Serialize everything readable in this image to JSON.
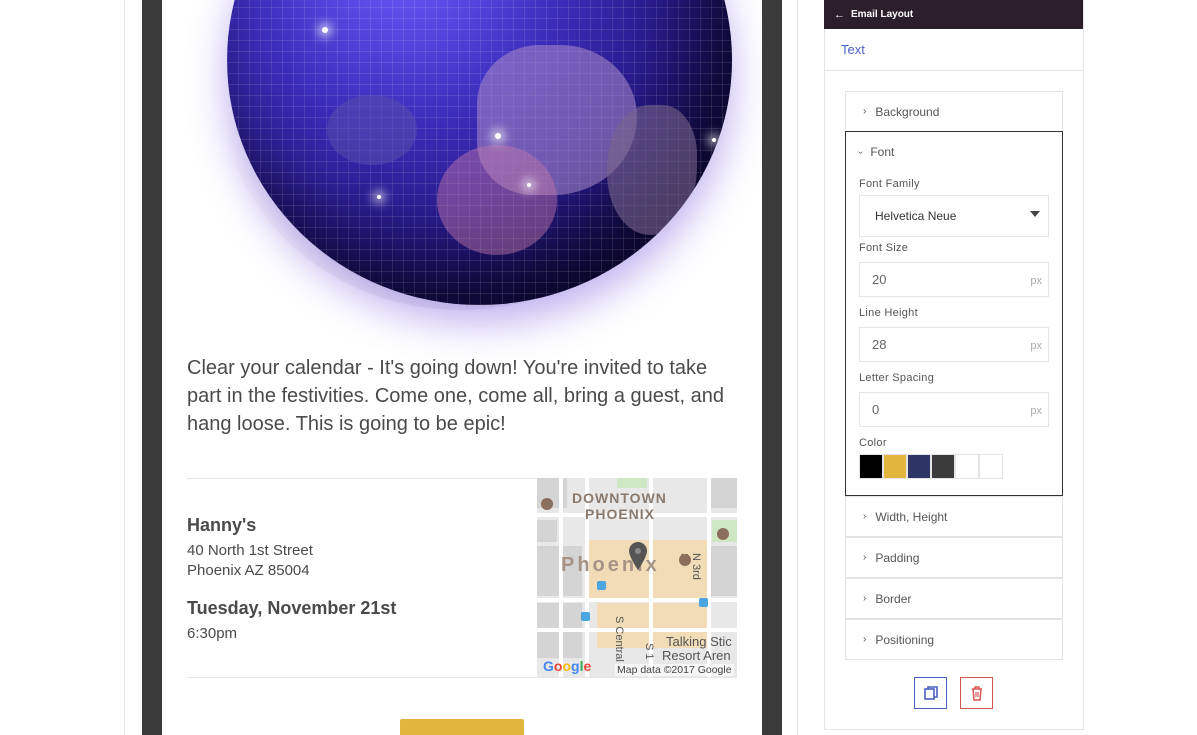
{
  "email": {
    "intro_text": "Clear your calendar - It's going down! You're invited to take part in the festivities. Come one, come all, bring a guest, and hang loose. This is going to be epic!",
    "venue_name": "Hanny's",
    "address_line1": "40 North 1st Street",
    "address_line2": "Phoenix AZ 85004",
    "date": "Tuesday, November 21st",
    "time": "6:30pm",
    "map": {
      "label_downtown": "DOWNTOWN",
      "label_phoenix_upper": "PHOENIX",
      "label_city": "Phoenix",
      "street_n3": "N 3rd St",
      "street_central": "S Central",
      "street_s1": "S 1",
      "poi_line1": "Talking Stic",
      "poi_line2": "Resort Aren",
      "google_letters": [
        "G",
        "o",
        "o",
        "g",
        "l",
        "e"
      ],
      "credit": "Map data ©2017 Google"
    }
  },
  "panel": {
    "header_title": "Email Layout",
    "back_icon": "arrow-left-icon",
    "element_type": "Text",
    "sections": {
      "background": "Background",
      "font": "Font",
      "width_height": "Width, Height",
      "padding": "Padding",
      "border": "Border",
      "positioning": "Positioning"
    },
    "font": {
      "family_label": "Font Family",
      "family_value": "Helvetica Neue",
      "size_label": "Font Size",
      "size_value": "20",
      "line_height_label": "Line Height",
      "line_height_value": "28",
      "letter_spacing_label": "Letter Spacing",
      "letter_spacing_value": "0",
      "unit": "px",
      "color_label": "Color",
      "swatches": [
        "#000000",
        "#e0b63f",
        "#2e3565",
        "#3b3b3b",
        "#ffffff",
        "#ffffff"
      ]
    },
    "actions": {
      "copy_icon": "copy-icon",
      "delete_icon": "trash-icon"
    }
  },
  "colors": {
    "accent": "#4a5fc1",
    "header_bg": "#2b1f2b",
    "cta": "#e0b63f",
    "danger": "#d9534f"
  }
}
